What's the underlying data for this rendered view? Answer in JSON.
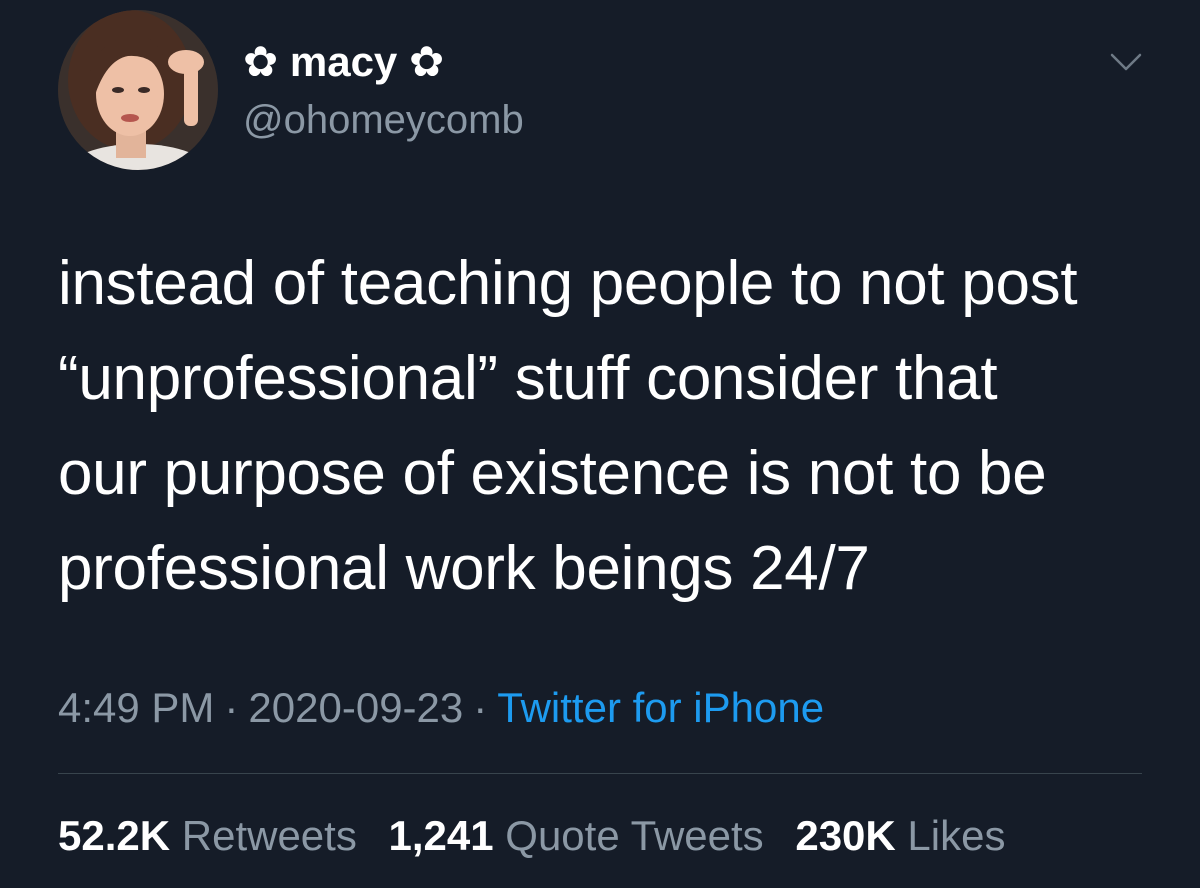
{
  "author": {
    "display_name": "✿ macy ✿",
    "handle": "@ohomeycomb",
    "avatar_icon": "profile-photo"
  },
  "tweet": {
    "lines": [
      "instead of teaching people to not post",
      "“unprofessional” stuff consider that",
      "our purpose of existence is not to be",
      "professional work beings 24/7"
    ]
  },
  "meta": {
    "time": "4:49 PM",
    "separator": "·",
    "date": "2020-09-23",
    "source": "Twitter for iPhone"
  },
  "stats": {
    "retweets_count": "52.2K",
    "retweets_label": "Retweets",
    "quotes_count": "1,241",
    "quotes_label": "Quote Tweets",
    "likes_count": "230K",
    "likes_label": "Likes"
  },
  "colors": {
    "background": "#151c28",
    "text_primary": "#ffffff",
    "text_secondary": "#8b98a5",
    "link": "#1d9bf0",
    "divider": "#38444d"
  },
  "icons": {
    "menu": "chevron-down-icon"
  }
}
